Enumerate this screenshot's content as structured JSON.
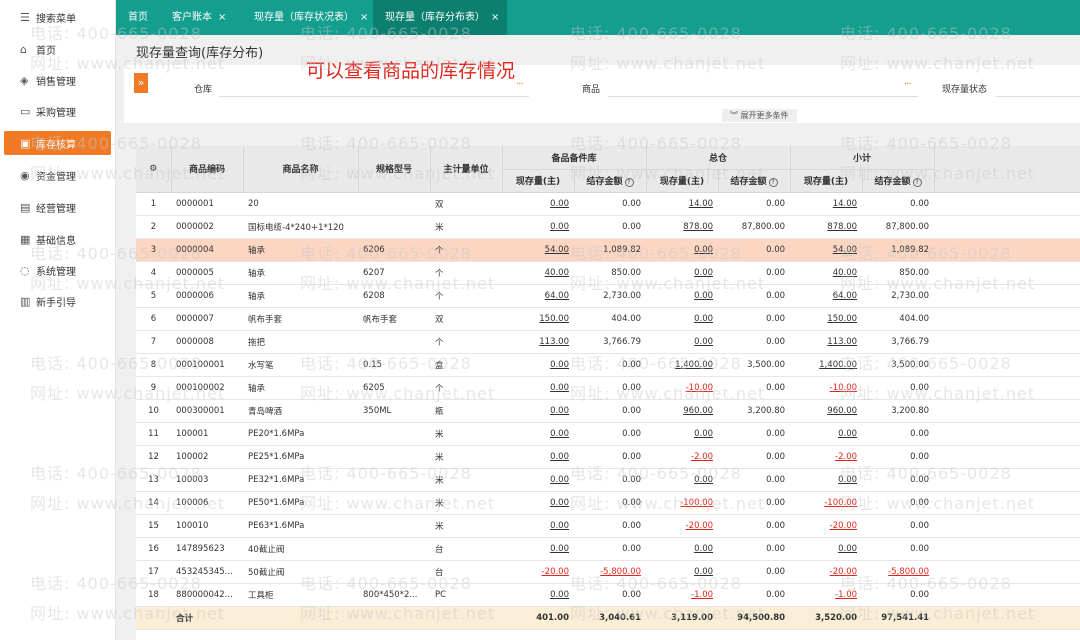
{
  "sidebar": {
    "items": [
      {
        "icon": "search-menu-icon",
        "glyph": "☰",
        "label": "搜索菜单"
      },
      {
        "icon": "home-icon",
        "glyph": "⌂",
        "label": "首页"
      },
      {
        "icon": "sales-icon",
        "glyph": "◈",
        "label": "销售管理"
      },
      {
        "icon": "purchase-icon",
        "glyph": "▭",
        "label": "采购管理"
      },
      {
        "icon": "inventory-icon",
        "glyph": "▣",
        "label": "库存核算"
      },
      {
        "icon": "funds-icon",
        "glyph": "◉",
        "label": "资金管理"
      },
      {
        "icon": "operations-icon",
        "glyph": "▤",
        "label": "经营管理"
      },
      {
        "icon": "basic-info-icon",
        "glyph": "▦",
        "label": "基础信息"
      },
      {
        "icon": "system-icon",
        "glyph": "◌",
        "label": "系统管理"
      },
      {
        "icon": "guide-icon",
        "glyph": "▥",
        "label": "新手引导"
      }
    ]
  },
  "tabs": [
    {
      "label": "首页",
      "closable": false
    },
    {
      "label": "客户账本",
      "closable": true
    },
    {
      "label": "现存量（库存状况表）",
      "closable": true
    },
    {
      "label": "现存量（库存分布表）",
      "closable": true
    }
  ],
  "page_title": "现存量查询(库存分布)",
  "overlay_text": "可以查看商品的库存情况",
  "filters": {
    "warehouse_label": "仓库",
    "product_label": "商品",
    "stock_status_label": "现存量状态",
    "more_conditions": "展开更多条件"
  },
  "table": {
    "headers": {
      "index_icon": "⚙",
      "code": "商品编码",
      "name": "商品名称",
      "spec": "规格型号",
      "unit": "主计量单位",
      "group1": "备品备件库",
      "group2": "总仓",
      "group3": "小计",
      "qty": "现存量(主)",
      "amount": "结存金额"
    },
    "rows": [
      {
        "idx": "1",
        "code": "0000001",
        "name": "20",
        "spec": "",
        "unit": "双",
        "q1": "0.00",
        "a1": "0.00",
        "q2": "14.00",
        "a2": "0.00",
        "q3": "14.00",
        "a3": "0.00"
      },
      {
        "idx": "2",
        "code": "0000002",
        "name": "国标电缆-4*240+1*120",
        "spec": "",
        "unit": "米",
        "q1": "0.00",
        "a1": "0.00",
        "q2": "878.00",
        "a2": "87,800.00",
        "q3": "878.00",
        "a3": "87,800.00"
      },
      {
        "idx": "3",
        "code": "0000004",
        "name": "轴承",
        "spec": "6206",
        "unit": "个",
        "q1": "54.00",
        "a1": "1,089.82",
        "q2": "0.00",
        "a2": "0.00",
        "q3": "54.00",
        "a3": "1,089.82"
      },
      {
        "idx": "4",
        "code": "0000005",
        "name": "轴承",
        "spec": "6207",
        "unit": "个",
        "q1": "40.00",
        "a1": "850.00",
        "q2": "0.00",
        "a2": "0.00",
        "q3": "40.00",
        "a3": "850.00"
      },
      {
        "idx": "5",
        "code": "0000006",
        "name": "轴承",
        "spec": "6208",
        "unit": "个",
        "q1": "64.00",
        "a1": "2,730.00",
        "q2": "0.00",
        "a2": "0.00",
        "q3": "64.00",
        "a3": "2,730.00"
      },
      {
        "idx": "6",
        "code": "0000007",
        "name": "帆布手套",
        "spec": "帆布手套",
        "unit": "双",
        "q1": "150.00",
        "a1": "404.00",
        "q2": "0.00",
        "a2": "0.00",
        "q3": "150.00",
        "a3": "404.00"
      },
      {
        "idx": "7",
        "code": "0000008",
        "name": "拖把",
        "spec": "",
        "unit": "个",
        "q1": "113.00",
        "a1": "3,766.79",
        "q2": "0.00",
        "a2": "0.00",
        "q3": "113.00",
        "a3": "3,766.79"
      },
      {
        "idx": "8",
        "code": "000100001",
        "name": "水写笔",
        "spec": "0.15",
        "unit": "盒",
        "q1": "0.00",
        "a1": "0.00",
        "q2": "1,400.00",
        "a2": "3,500.00",
        "q3": "1,400.00",
        "a3": "3,500.00"
      },
      {
        "idx": "9",
        "code": "000100002",
        "name": "轴承",
        "spec": "6205",
        "unit": "个",
        "q1": "0.00",
        "a1": "0.00",
        "q2": "-10.00",
        "a2": "0.00",
        "q3": "-10.00",
        "a3": "0.00"
      },
      {
        "idx": "10",
        "code": "000300001",
        "name": "青岛啤酒",
        "spec": "350ML",
        "unit": "瓶",
        "q1": "0.00",
        "a1": "0.00",
        "q2": "960.00",
        "a2": "3,200.80",
        "q3": "960.00",
        "a3": "3,200.80"
      },
      {
        "idx": "11",
        "code": "100001",
        "name": "PE20*1.6MPa",
        "spec": "",
        "unit": "米",
        "q1": "0.00",
        "a1": "0.00",
        "q2": "0.00",
        "a2": "0.00",
        "q3": "0.00",
        "a3": "0.00"
      },
      {
        "idx": "12",
        "code": "100002",
        "name": "PE25*1.6MPa",
        "spec": "",
        "unit": "米",
        "q1": "0.00",
        "a1": "0.00",
        "q2": "-2.00",
        "a2": "0.00",
        "q3": "-2.00",
        "a3": "0.00"
      },
      {
        "idx": "13",
        "code": "100003",
        "name": "PE32*1.6MPa",
        "spec": "",
        "unit": "米",
        "q1": "0.00",
        "a1": "0.00",
        "q2": "0.00",
        "a2": "0.00",
        "q3": "0.00",
        "a3": "0.00"
      },
      {
        "idx": "14",
        "code": "100006",
        "name": "PE50*1.6MPa",
        "spec": "",
        "unit": "米",
        "q1": "0.00",
        "a1": "0.00",
        "q2": "-100.00",
        "a2": "0.00",
        "q3": "-100.00",
        "a3": "0.00"
      },
      {
        "idx": "15",
        "code": "100010",
        "name": "PE63*1.6MPa",
        "spec": "",
        "unit": "米",
        "q1": "0.00",
        "a1": "0.00",
        "q2": "-20.00",
        "a2": "0.00",
        "q3": "-20.00",
        "a3": "0.00"
      },
      {
        "idx": "16",
        "code": "147895623",
        "name": "40截止阀",
        "spec": "",
        "unit": "台",
        "q1": "0.00",
        "a1": "0.00",
        "q2": "0.00",
        "a2": "0.00",
        "q3": "0.00",
        "a3": "0.00"
      },
      {
        "idx": "17",
        "code": "453245345...",
        "name": "50截止阀",
        "spec": "",
        "unit": "台",
        "q1": "-20.00",
        "a1": "-5,800.00",
        "q2": "0.00",
        "a2": "0.00",
        "q3": "-20.00",
        "a3": "-5,800.00"
      },
      {
        "idx": "18",
        "code": "880000042...",
        "name": "工具柜",
        "spec": "800*450*2...",
        "unit": "PC",
        "q1": "0.00",
        "a1": "0.00",
        "q2": "-1.00",
        "a2": "0.00",
        "q3": "-1.00",
        "a3": "0.00"
      }
    ],
    "total": {
      "label": "合计",
      "q1": "401.00",
      "a1": "3,040.61",
      "q2": "3,119.00",
      "a2": "94,500.80",
      "q3": "3,520.00",
      "a3": "97,541.41"
    }
  },
  "watermark": {
    "phone": "电话: 400-665-0028",
    "site": "网址: www.chanjet.net"
  },
  "colors": {
    "topbar": "#139e8e",
    "accent": "#f07a26",
    "negative": "#e0261d",
    "highlight_row": "#fbd6c3",
    "total_row": "#fbeed6"
  }
}
